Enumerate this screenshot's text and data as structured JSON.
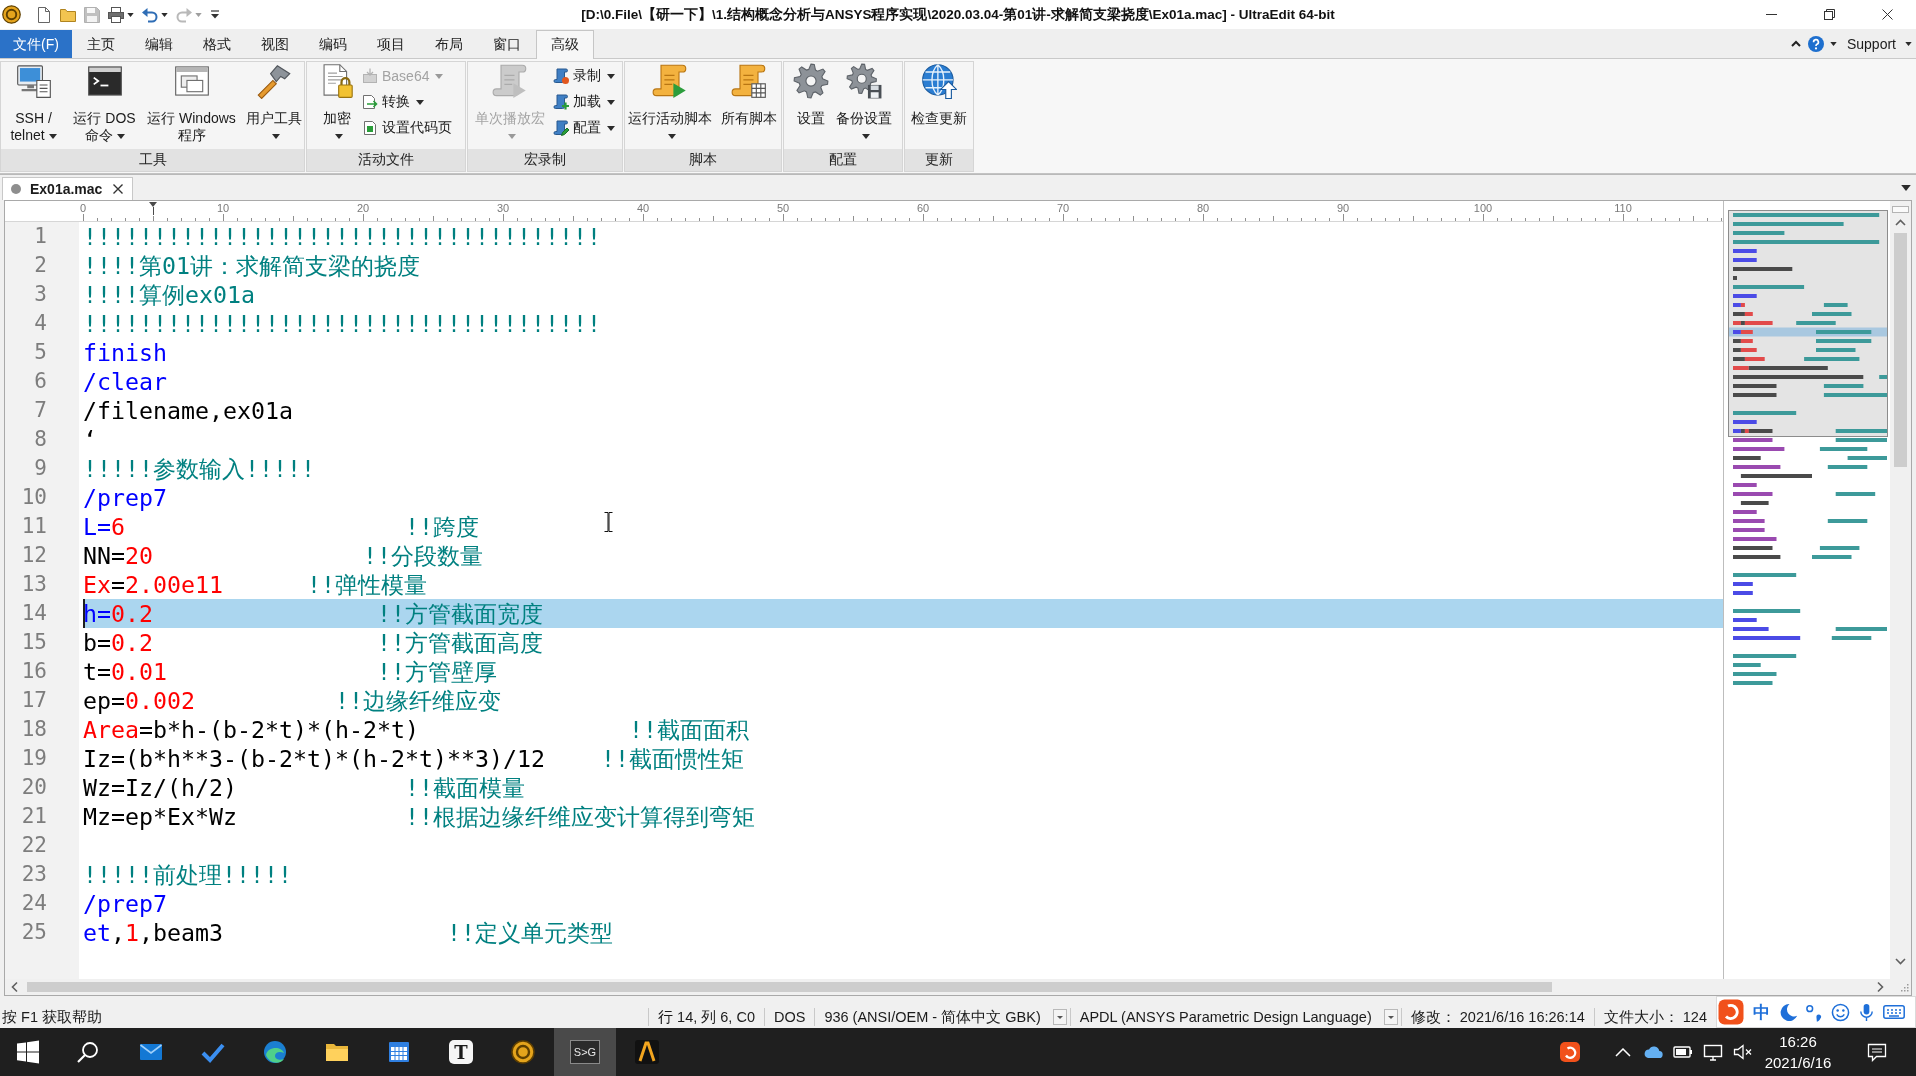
{
  "title_bar": {
    "title": "[D:\\0.File\\【研一下】\\1.结构概念分析与ANSYS程序实现\\2020.03.04-第01讲-求解简支梁挠度\\Ex01a.mac] - UltraEdit 64-bit",
    "quick_access": [
      {
        "kind": "new",
        "disabled": false,
        "dropdown": false
      },
      {
        "kind": "open",
        "disabled": false,
        "dropdown": false
      },
      {
        "kind": "save",
        "disabled": true,
        "dropdown": false
      },
      {
        "kind": "print",
        "disabled": false,
        "dropdown": true
      },
      {
        "kind": "undo",
        "disabled": false,
        "dropdown": true
      },
      {
        "kind": "redo",
        "disabled": true,
        "dropdown": true
      },
      {
        "kind": "customize",
        "disabled": false,
        "dropdown": false
      }
    ]
  },
  "menu_tabs": [
    {
      "kind": "file",
      "label": "文件(F)",
      "selected": false
    },
    {
      "kind": "tab",
      "label": "主页",
      "selected": false
    },
    {
      "kind": "tab",
      "label": "编辑",
      "selected": false
    },
    {
      "kind": "tab",
      "label": "格式",
      "selected": false
    },
    {
      "kind": "tab",
      "label": "视图",
      "selected": false
    },
    {
      "kind": "tab",
      "label": "编码",
      "selected": false
    },
    {
      "kind": "tab",
      "label": "项目",
      "selected": false
    },
    {
      "kind": "tab",
      "label": "布局",
      "selected": false
    },
    {
      "kind": "tab",
      "label": "窗口",
      "selected": false
    },
    {
      "kind": "tab",
      "label": "高级",
      "selected": true
    }
  ],
  "help_bar": {
    "label": "Support"
  },
  "ribbon": {
    "groups": [
      {
        "label": "工具",
        "items": [
          {
            "kind": "large",
            "label": "SSH / telnet",
            "dropdown": true,
            "disabled": false
          },
          {
            "kind": "large",
            "label": "运行 DOS 命令",
            "dropdown": true,
            "disabled": false
          },
          {
            "kind": "large",
            "label": "运行 Windows 程序",
            "dropdown": false,
            "disabled": false
          },
          {
            "kind": "large",
            "label": "用户工具",
            "dropdown": true,
            "disabled": false
          }
        ]
      },
      {
        "label": "活动文件",
        "items": [
          {
            "kind": "large",
            "label": "加密",
            "dropdown": true,
            "disabled": false
          },
          {
            "kind": "small",
            "label": "Base64",
            "dropdown": true,
            "disabled": true
          },
          {
            "kind": "small",
            "label": "转换",
            "dropdown": true,
            "disabled": false
          },
          {
            "kind": "small",
            "label": "设置代码页",
            "dropdown": false,
            "disabled": false
          }
        ]
      },
      {
        "label": "宏录制",
        "items": [
          {
            "kind": "large",
            "label": "单次播放宏",
            "dropdown": true,
            "disabled": true
          },
          {
            "kind": "small",
            "label": "录制",
            "dropdown": true,
            "disabled": false
          },
          {
            "kind": "small",
            "label": "加载",
            "dropdown": true,
            "disabled": false
          },
          {
            "kind": "small",
            "label": "配置",
            "dropdown": true,
            "disabled": false
          }
        ]
      },
      {
        "label": "脚本",
        "items": [
          {
            "kind": "large",
            "label": "运行活动脚本",
            "dropdown": true,
            "disabled": false
          },
          {
            "kind": "large",
            "label": "所有脚本",
            "dropdown": false,
            "disabled": false
          }
        ]
      },
      {
        "label": "配置",
        "items": [
          {
            "kind": "large",
            "label": "设置",
            "dropdown": false,
            "disabled": false
          },
          {
            "kind": "large",
            "label": "备份设置",
            "dropdown": true,
            "disabled": false
          }
        ]
      },
      {
        "label": "更新",
        "items": [
          {
            "kind": "large",
            "label": "检查更新",
            "dropdown": false,
            "disabled": false
          }
        ]
      }
    ]
  },
  "document_tabs": [
    {
      "label": "Ex01a.mac",
      "selected": true
    }
  ],
  "editor": {
    "ruler_labels": [
      "0",
      "10",
      "20",
      "30",
      "40",
      "50",
      "60",
      "70",
      "80",
      "90",
      "100",
      "110"
    ],
    "lines": [
      {
        "number": "1",
        "current": false,
        "tokens": [
          {
            "kind": "comment",
            "text": "!!!!!!!!!!!!!!!!!!!!!!!!!!!!!!!!!!!!!"
          }
        ]
      },
      {
        "number": "2",
        "current": false,
        "tokens": [
          {
            "kind": "comment",
            "text": "!!!!第01讲：求解简支梁的挠度"
          }
        ]
      },
      {
        "number": "3",
        "current": false,
        "tokens": [
          {
            "kind": "comment",
            "text": "!!!!算例ex01a"
          }
        ]
      },
      {
        "number": "4",
        "current": false,
        "tokens": [
          {
            "kind": "comment",
            "text": "!!!!!!!!!!!!!!!!!!!!!!!!!!!!!!!!!!!!!"
          }
        ]
      },
      {
        "number": "5",
        "current": false,
        "tokens": [
          {
            "kind": "keyword",
            "text": "finish"
          }
        ]
      },
      {
        "number": "6",
        "current": false,
        "tokens": [
          {
            "kind": "keyword",
            "text": "/clear"
          }
        ]
      },
      {
        "number": "7",
        "current": false,
        "tokens": [
          {
            "kind": "plain",
            "text": "/filename,ex01a"
          }
        ]
      },
      {
        "number": "8",
        "current": false,
        "tokens": [
          {
            "kind": "plain",
            "text": "‘"
          }
        ]
      },
      {
        "number": "9",
        "current": false,
        "tokens": [
          {
            "kind": "comment",
            "text": "!!!!!参数输入!!!!!"
          }
        ]
      },
      {
        "number": "10",
        "current": false,
        "tokens": [
          {
            "kind": "keyword",
            "text": "/prep7"
          }
        ]
      },
      {
        "number": "11",
        "current": false,
        "tokens": [
          {
            "kind": "keyword",
            "text": "L="
          },
          {
            "kind": "number",
            "text": "6"
          },
          {
            "kind": "comment",
            "text": "                    !!跨度"
          }
        ]
      },
      {
        "number": "12",
        "current": false,
        "tokens": [
          {
            "kind": "plain",
            "text": "NN="
          },
          {
            "kind": "number",
            "text": "20"
          },
          {
            "kind": "comment",
            "text": "               !!分段数量"
          }
        ]
      },
      {
        "number": "13",
        "current": false,
        "tokens": [
          {
            "kind": "variable",
            "text": "Ex"
          },
          {
            "kind": "plain",
            "text": "="
          },
          {
            "kind": "number",
            "text": "2.00e11"
          },
          {
            "kind": "comment",
            "text": "      !!弹性模量"
          }
        ]
      },
      {
        "number": "14",
        "current": true,
        "tokens": [
          {
            "kind": "keyword",
            "text": "h="
          },
          {
            "kind": "number",
            "text": "0.2"
          },
          {
            "kind": "comment",
            "text": "                !!方管截面宽度"
          }
        ]
      },
      {
        "number": "15",
        "current": false,
        "tokens": [
          {
            "kind": "plain",
            "text": "b="
          },
          {
            "kind": "number",
            "text": "0.2"
          },
          {
            "kind": "comment",
            "text": "                !!方管截面高度"
          }
        ]
      },
      {
        "number": "16",
        "current": false,
        "tokens": [
          {
            "kind": "plain",
            "text": "t="
          },
          {
            "kind": "number",
            "text": "0.01"
          },
          {
            "kind": "comment",
            "text": "               !!方管壁厚"
          }
        ]
      },
      {
        "number": "17",
        "current": false,
        "tokens": [
          {
            "kind": "plain",
            "text": "ep="
          },
          {
            "kind": "number",
            "text": "0.002"
          },
          {
            "kind": "comment",
            "text": "          !!边缘纤维应变"
          }
        ]
      },
      {
        "number": "18",
        "current": false,
        "tokens": [
          {
            "kind": "variable",
            "text": "Area"
          },
          {
            "kind": "plain",
            "text": "=b*h-(b-2*t)*(h-2*t)"
          },
          {
            "kind": "comment",
            "text": "               !!截面面积"
          }
        ]
      },
      {
        "number": "19",
        "current": false,
        "tokens": [
          {
            "kind": "plain",
            "text": "Iz=(b*h**3-(b-2*t)*(h-2*t)**3)/12"
          },
          {
            "kind": "comment",
            "text": "    !!截面惯性矩"
          }
        ]
      },
      {
        "number": "20",
        "current": false,
        "tokens": [
          {
            "kind": "plain",
            "text": "Wz=Iz/(h/2)"
          },
          {
            "kind": "comment",
            "text": "            !!截面模量"
          }
        ]
      },
      {
        "number": "21",
        "current": false,
        "tokens": [
          {
            "kind": "plain",
            "text": "Mz=ep*Ex*Wz"
          },
          {
            "kind": "comment",
            "text": "            !!根据边缘纤维应变计算得到弯矩"
          }
        ]
      },
      {
        "number": "22",
        "current": false
      },
      {
        "number": "23",
        "current": false,
        "tokens": [
          {
            "kind": "comment",
            "text": "!!!!!前处理!!!!!"
          }
        ]
      },
      {
        "number": "24",
        "current": false,
        "tokens": [
          {
            "kind": "keyword",
            "text": "/prep7"
          }
        ]
      },
      {
        "number": "25",
        "current": false,
        "tokens": [
          {
            "kind": "keyword",
            "text": "et"
          },
          {
            "kind": "plain",
            "text": ","
          },
          {
            "kind": "number",
            "text": "1"
          },
          {
            "kind": "plain",
            "text": ",beam3"
          },
          {
            "kind": "comment",
            "text": "                !!定义单元类型"
          }
        ]
      }
    ]
  },
  "status_bar": {
    "help": "按 F1 获取帮助",
    "position": "行 14, 列 6, C0",
    "line_ending": "DOS",
    "encoding": "936 (ANSI/OEM - 简体中文 GBK)",
    "syntax": "APDL (ANSYS Parametric Design Language)",
    "modified": "修改： 2021/6/16 16:26:14",
    "file_size": "文件大小： 124"
  },
  "ime_toolbar": {
    "mode": "中"
  },
  "taskbar": {
    "buttons": [
      {
        "kind": "start",
        "selected": false
      },
      {
        "kind": "search",
        "selected": false
      },
      {
        "kind": "mail",
        "selected": false
      },
      {
        "kind": "todo",
        "selected": false
      },
      {
        "kind": "browser",
        "selected": false
      },
      {
        "kind": "folder",
        "selected": false
      },
      {
        "kind": "calendar",
        "selected": false
      },
      {
        "kind": "letter",
        "label": "T",
        "selected": false
      },
      {
        "kind": "logo",
        "selected": false
      },
      {
        "kind": "capture",
        "label": "S>G",
        "selected": true
      },
      {
        "kind": "peak",
        "selected": false
      }
    ],
    "time": "16:26",
    "date": "2021/6/16"
  }
}
